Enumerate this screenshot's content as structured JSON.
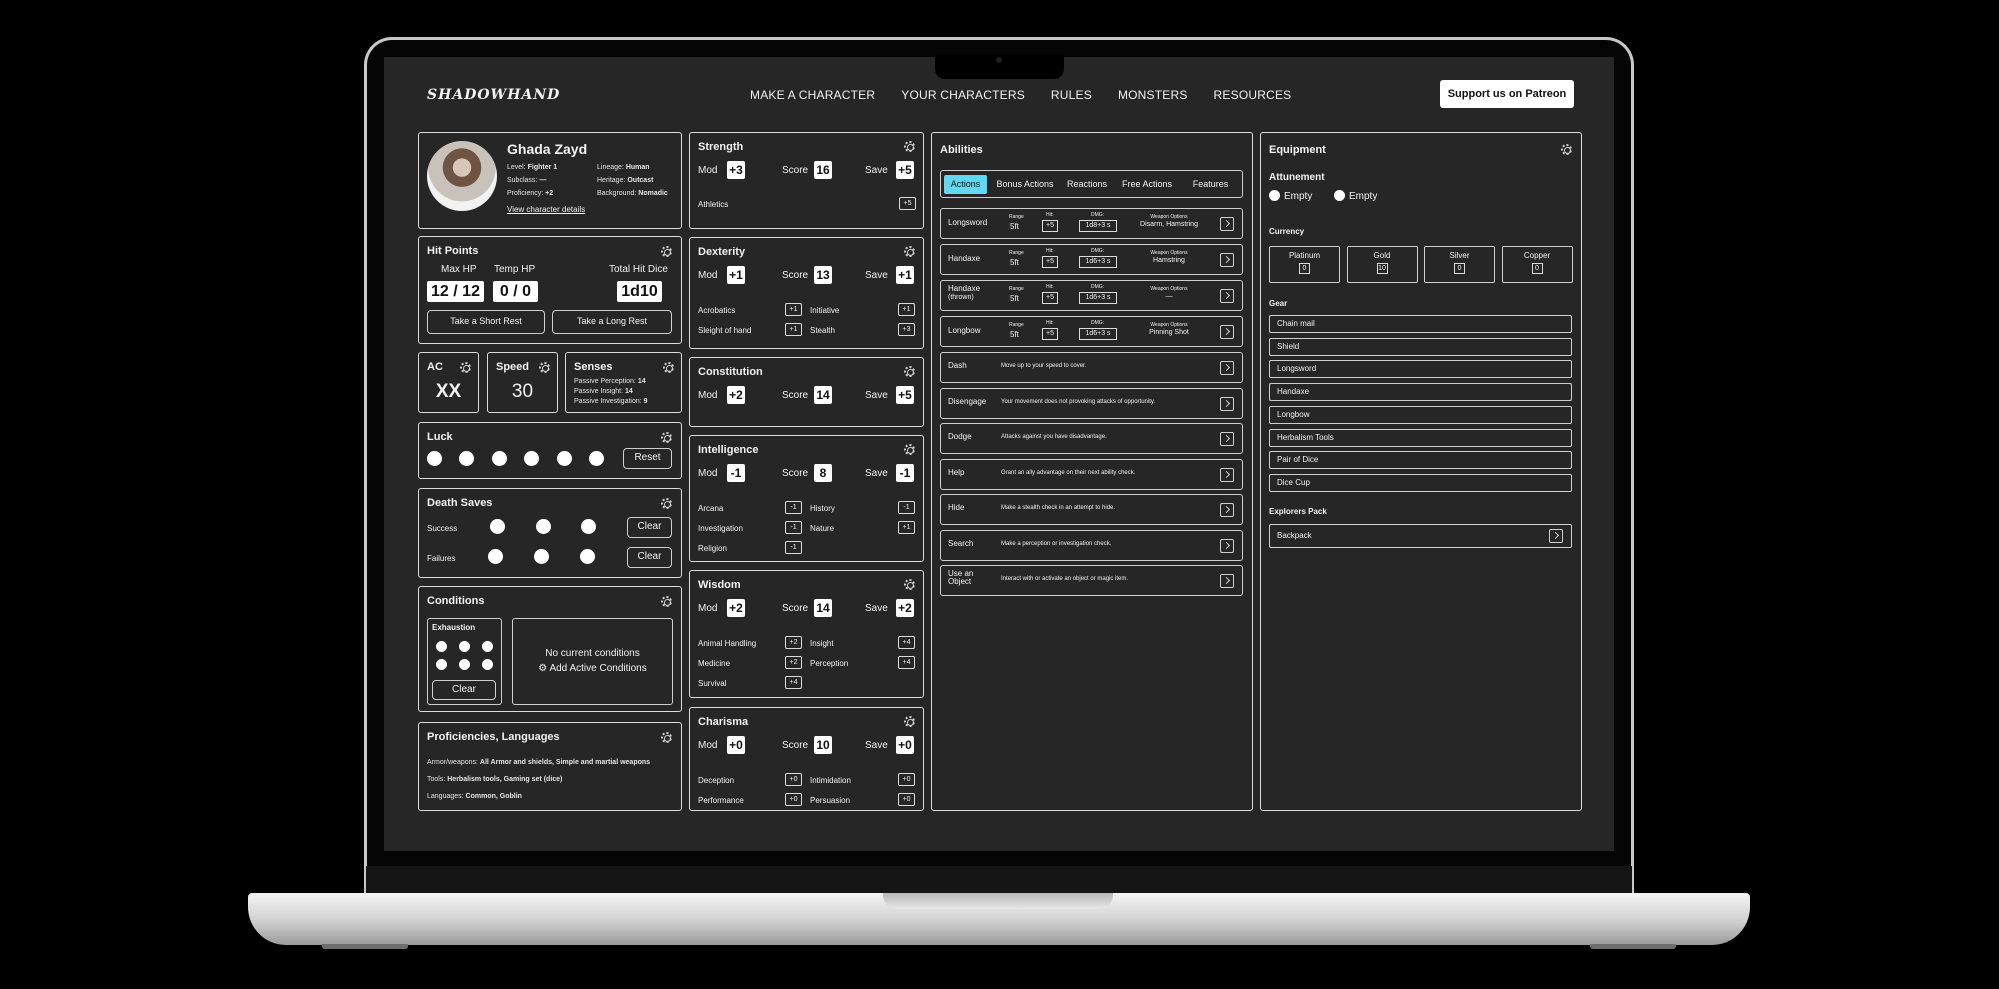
{
  "nav": {
    "logo": "SHADOWHAND",
    "links": [
      "MAKE A CHARACTER",
      "YOUR CHARACTERS",
      "RULES",
      "MONSTERS",
      "RESOURCES"
    ],
    "patreon": "Support us on Patreon"
  },
  "character": {
    "name": "Ghada Zayd",
    "level_label": "Level:",
    "level": "Fighter 1",
    "subclass_label": "Subclass:",
    "subclass": "—",
    "proficiency_label": "Proficiency:",
    "proficiency": "+2",
    "lineage_label": "Lineage:",
    "lineage": "Human",
    "heritage_label": "Heritage:",
    "heritage": "Outcast",
    "background_label": "Background:",
    "background": "Nomadic",
    "details_link": "View character details"
  },
  "hp": {
    "title": "Hit Points",
    "max_label": "Max HP",
    "temp_label": "Temp HP",
    "dice_label": "Total Hit Dice",
    "max": "12 / 12",
    "temp": "0 / 0",
    "dice": "1d10",
    "short_rest": "Take a Short Rest",
    "long_rest": "Take a Long Rest"
  },
  "ac": {
    "title": "AC",
    "value": "XX"
  },
  "speed": {
    "title": "Speed",
    "value": "30"
  },
  "senses": {
    "title": "Senses",
    "perception_label": "Passive Perception:",
    "perception": "14",
    "insight_label": "Passive Insight:",
    "insight": "14",
    "investigation_label": "Passive Investigation:",
    "investigation": "9"
  },
  "luck": {
    "title": "Luck",
    "reset": "Reset"
  },
  "death": {
    "title": "Death Saves",
    "success": "Success",
    "failures": "Failures",
    "clear": "Clear"
  },
  "conditions": {
    "title": "Conditions",
    "exhaustion": "Exhaustion",
    "clear": "Clear",
    "none": "No current conditions",
    "add": "Add Active Conditions"
  },
  "prof": {
    "title": "Proficiencies, Languages",
    "armor_label": "Armor/weapons:",
    "armor": "All Armor and shields, Simple and martial weapons",
    "tools_label": "Tools:",
    "tools": "Herbalism tools, Gaming set (dice)",
    "lang_label": "Languages:",
    "lang": "Common, Goblin"
  },
  "stat_labels": {
    "mod": "Mod",
    "score": "Score",
    "save": "Save"
  },
  "stats": [
    {
      "name": "Strength",
      "mod": "+3",
      "score": "16",
      "save": "+5",
      "skills": [
        {
          "name": "Athletics",
          "v": "+5"
        }
      ]
    },
    {
      "name": "Dexterity",
      "mod": "+1",
      "score": "13",
      "save": "+1",
      "skills": [
        {
          "name": "Acrobatics",
          "v": "+1"
        },
        {
          "name": "Initiative",
          "v": "+1"
        },
        {
          "name": "Sleight of hand",
          "v": "+1"
        },
        {
          "name": "Stealth",
          "v": "+3"
        }
      ]
    },
    {
      "name": "Constitution",
      "mod": "+2",
      "score": "14",
      "save": "+5",
      "skills": []
    },
    {
      "name": "Intelligence",
      "mod": "-1",
      "score": "8",
      "save": "-1",
      "skills": [
        {
          "name": "Arcana",
          "v": "-1"
        },
        {
          "name": "History",
          "v": "-1"
        },
        {
          "name": "Investigation",
          "v": "-1"
        },
        {
          "name": "Nature",
          "v": "+1"
        },
        {
          "name": "Religion",
          "v": "-1"
        }
      ]
    },
    {
      "name": "Wisdom",
      "mod": "+2",
      "score": "14",
      "save": "+2",
      "skills": [
        {
          "name": "Animal Handling",
          "v": "+2"
        },
        {
          "name": "Insight",
          "v": "+4"
        },
        {
          "name": "Medicine",
          "v": "+2"
        },
        {
          "name": "Perception",
          "v": "+4"
        },
        {
          "name": "Survival",
          "v": "+4"
        }
      ]
    },
    {
      "name": "Charisma",
      "mod": "+0",
      "score": "10",
      "save": "+0",
      "skills": [
        {
          "name": "Deception",
          "v": "+0"
        },
        {
          "name": "Intimidation",
          "v": "+0"
        },
        {
          "name": "Performance",
          "v": "+0"
        },
        {
          "name": "Persuasion",
          "v": "+0"
        }
      ]
    }
  ],
  "abilities": {
    "title": "Abilities",
    "tabs": [
      "Actions",
      "Bonus Actions",
      "Reactions",
      "Free Actions",
      "Features"
    ],
    "labels": {
      "range": "Range",
      "hit": "Hit:",
      "dmg": "DMG:",
      "opts": "Weapon Options"
    },
    "weapons": [
      {
        "name": "Longsword",
        "sub": "",
        "range": "5ft",
        "hit": "+5",
        "dmg": "1d8+3 s",
        "opts": "Disarm, Hamstring"
      },
      {
        "name": "Handaxe",
        "sub": "",
        "range": "5ft",
        "hit": "+5",
        "dmg": "1d6+3 s",
        "opts": "Hamstring"
      },
      {
        "name": "Handaxe",
        "sub": "(thrown)",
        "range": "5ft",
        "hit": "+5",
        "dmg": "1d6+3 s",
        "opts": "—"
      },
      {
        "name": "Longbow",
        "sub": "",
        "range": "5ft",
        "hit": "+5",
        "dmg": "1d6+3 s",
        "opts": "Pinning Shot"
      }
    ],
    "actions": [
      {
        "name": "Dash",
        "desc": "Move up to your speed to cover."
      },
      {
        "name": "Disengage",
        "desc": "Your movement does not provoking attacks of opportunity."
      },
      {
        "name": "Dodge",
        "desc": "Attacks against you have disadvantage."
      },
      {
        "name": "Help",
        "desc": "Grant an ally advantage on their next ability check."
      },
      {
        "name": "Hide",
        "desc": "Make a stealth check in an attempt to hide."
      },
      {
        "name": "Search",
        "desc": "Make a perception or investigation check."
      },
      {
        "name": "Use an Object",
        "desc": "Interact with or activate an object or magic item."
      }
    ]
  },
  "equipment": {
    "title": "Equipment",
    "attunement": "Attunement",
    "empty": "Empty",
    "currency_title": "Currency",
    "currency": [
      {
        "name": "Platinum",
        "v": "0"
      },
      {
        "name": "Gold",
        "v": "10"
      },
      {
        "name": "Silver",
        "v": "0"
      },
      {
        "name": "Copper",
        "v": "0"
      }
    ],
    "gear_title": "Gear",
    "gear": [
      "Chain mail",
      "Shield",
      "Longsword",
      "Handaxe",
      "Longbow",
      "Herbalism Tools",
      "Pair of Dice",
      "Dice Cup"
    ],
    "pack_title": "Explorers Pack",
    "pack": "Backpack"
  }
}
